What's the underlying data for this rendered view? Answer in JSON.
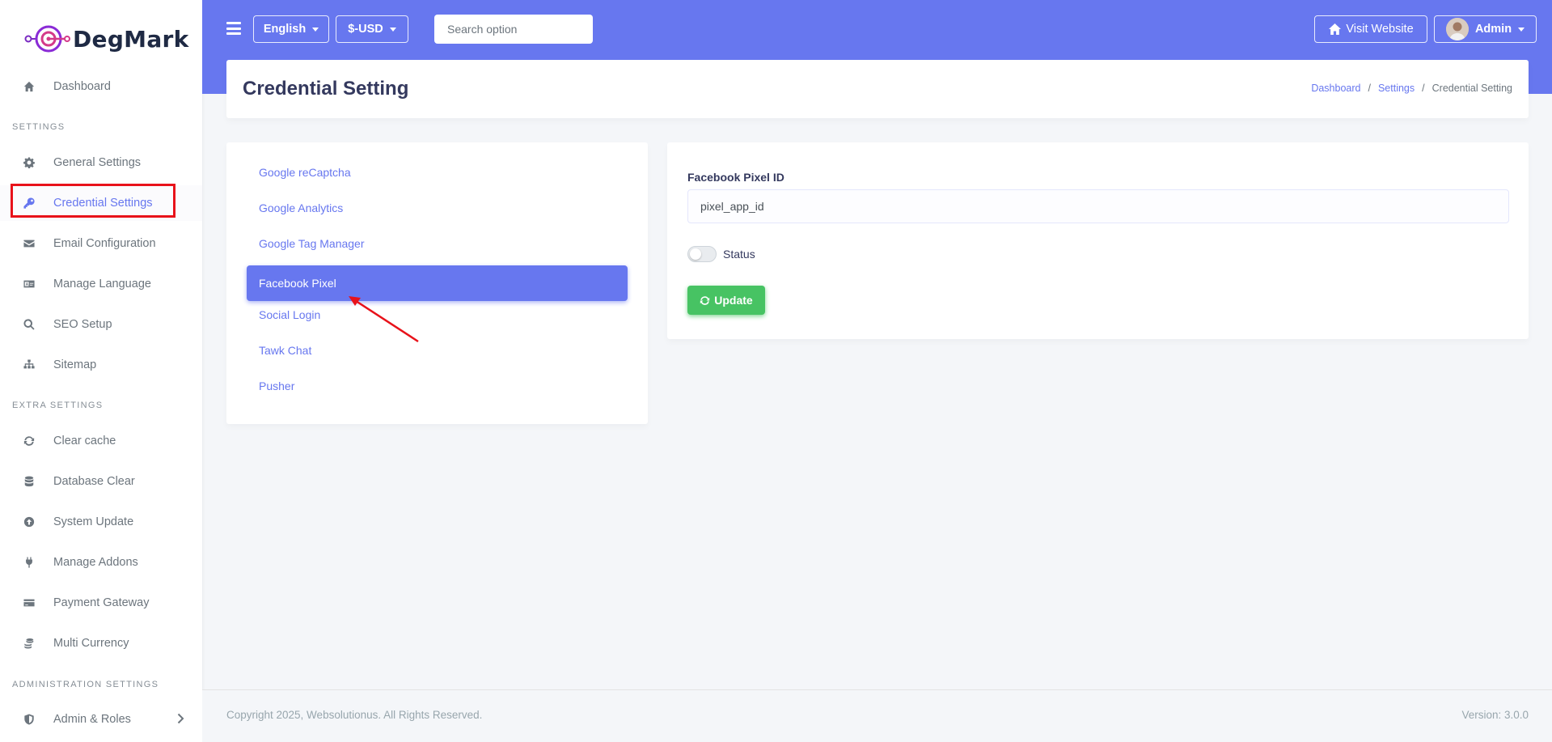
{
  "brand": {
    "name": "DegMark"
  },
  "sidebar": {
    "dashboard": "Dashboard",
    "section_settings": "SETTINGS",
    "items_settings": [
      {
        "label": "General Settings",
        "icon": "gear-icon"
      },
      {
        "label": "Credential Settings",
        "icon": "key-icon"
      },
      {
        "label": "Email Configuration",
        "icon": "envelope-icon"
      },
      {
        "label": "Manage Language",
        "icon": "language-icon"
      },
      {
        "label": "SEO Setup",
        "icon": "search-icon"
      },
      {
        "label": "Sitemap",
        "icon": "sitemap-icon"
      }
    ],
    "section_extra": "EXTRA SETTINGS",
    "items_extra": [
      {
        "label": "Clear cache",
        "icon": "sync-icon"
      },
      {
        "label": "Database Clear",
        "icon": "database-icon"
      },
      {
        "label": "System Update",
        "icon": "upload-icon"
      },
      {
        "label": "Manage Addons",
        "icon": "plug-icon"
      },
      {
        "label": "Payment Gateway",
        "icon": "credit-card-icon"
      },
      {
        "label": "Multi Currency",
        "icon": "coins-icon"
      }
    ],
    "section_admin": "ADMINISTRATION SETTINGS",
    "admin_roles": "Admin & Roles"
  },
  "topbar": {
    "language": "English",
    "currency": "$-USD",
    "search_placeholder": "Search option",
    "visit_website": "Visit Website",
    "user": "Admin"
  },
  "page": {
    "title": "Credential Setting",
    "breadcrumb": [
      "Dashboard",
      "Settings",
      "Credential Setting"
    ]
  },
  "credential_menu": [
    "Google reCaptcha",
    "Google Analytics",
    "Google Tag Manager",
    "Facebook Pixel",
    "Social Login",
    "Tawk Chat",
    "Pusher"
  ],
  "form": {
    "field_label": "Facebook Pixel ID",
    "field_value": "pixel_app_id",
    "status_label": "Status",
    "status_on": false,
    "update_label": "Update"
  },
  "footer": {
    "copyright": "Copyright 2025, Websolutionus. All Rights Reserved.",
    "version": "Version: 3.0.0"
  },
  "colors": {
    "primary": "#6777ef",
    "success": "#47c363",
    "annotation": "#e8121a"
  }
}
